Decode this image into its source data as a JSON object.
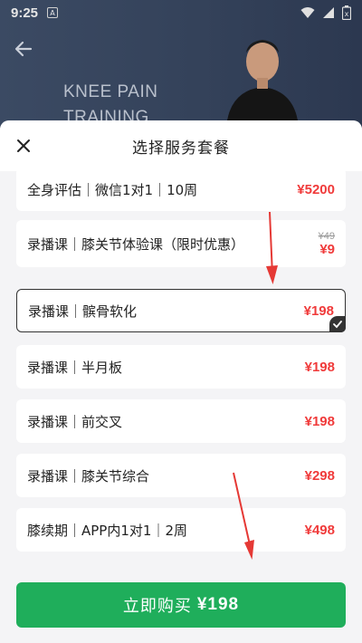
{
  "status_bar": {
    "time": "9:25",
    "a_icon": "A"
  },
  "background": {
    "title_line1": "KNEE PAIN",
    "title_line2": "TRAINING"
  },
  "sheet": {
    "title": "选择服务套餐",
    "items": [
      {
        "label": "全身评估｜微信1对1｜10周",
        "price": "¥5200",
        "original_price": "",
        "selected": false
      },
      {
        "label": "录播课｜膝关节体验课（限时优惠）",
        "price": "¥9",
        "original_price": "¥49",
        "selected": false
      },
      {
        "label": "录播课｜髌骨软化",
        "price": "¥198",
        "original_price": "",
        "selected": true
      },
      {
        "label": "录播课｜半月板",
        "price": "¥198",
        "original_price": "",
        "selected": false
      },
      {
        "label": "录播课｜前交叉",
        "price": "¥198",
        "original_price": "",
        "selected": false
      },
      {
        "label": "录播课｜膝关节综合",
        "price": "¥298",
        "original_price": "",
        "selected": false
      },
      {
        "label": "膝续期｜APP内1对1｜2周",
        "price": "¥498",
        "original_price": "",
        "selected": false
      }
    ],
    "buy_button": {
      "label": "立即购买",
      "price": "¥198"
    }
  },
  "colors": {
    "price_red": "#f03b3b",
    "buy_green": "#1fae5b",
    "annotation_red": "#e53935"
  }
}
